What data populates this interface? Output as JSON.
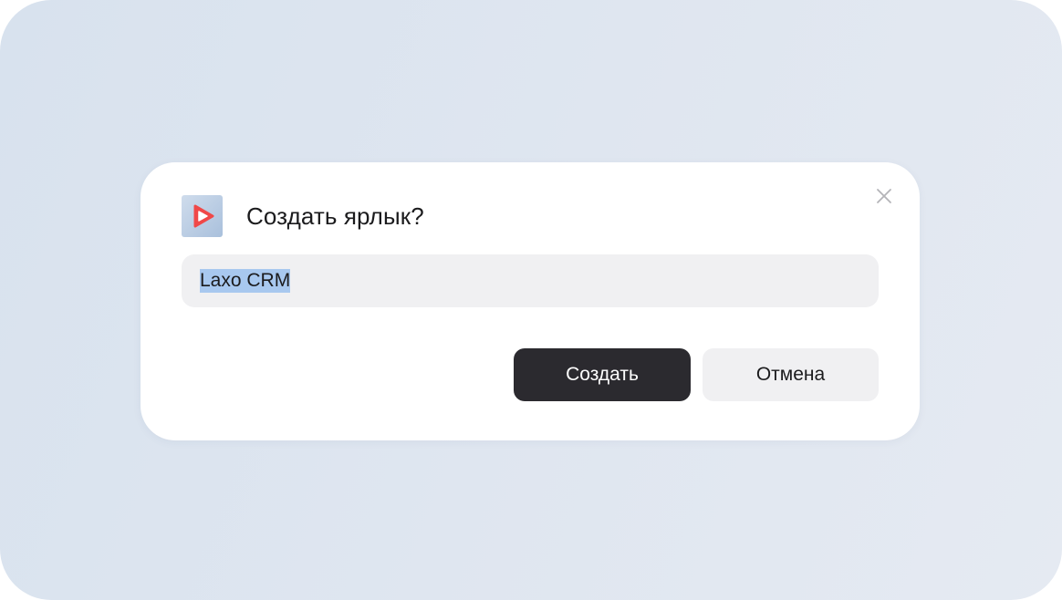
{
  "dialog": {
    "title": "Создать ярлык?",
    "app_icon": "laxo-crm-app-icon",
    "close_icon": "close-icon",
    "name_field": {
      "value": "Laxo CRM",
      "selected": true
    },
    "buttons": {
      "create_label": "Создать",
      "cancel_label": "Отмена"
    }
  },
  "colors": {
    "backdrop": "#dbe3ee",
    "dialog_bg": "#ffffff",
    "field_bg": "#f0f0f2",
    "selection": "#a8c8ef",
    "primary_button": "#2b2a2f",
    "secondary_button": "#f0f0f2",
    "icon_red": "#f04848"
  }
}
